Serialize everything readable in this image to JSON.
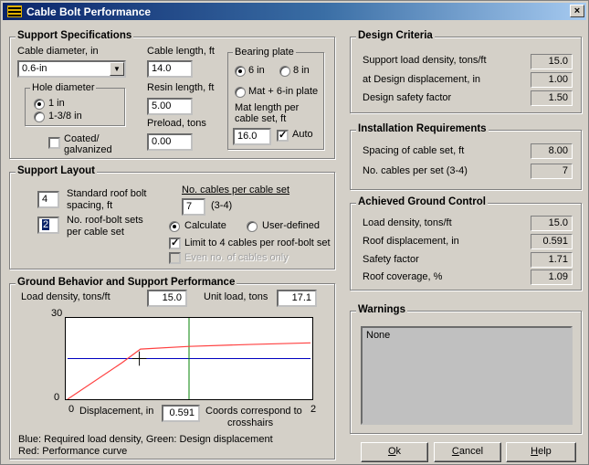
{
  "window": {
    "title": "Cable Bolt Performance",
    "close": "×"
  },
  "support_specs": {
    "title": "Support Specifications",
    "cable_diameter_label": "Cable diameter, in",
    "cable_diameter_value": "0.6-in",
    "cable_length_label": "Cable length, ft",
    "cable_length_value": "14.0",
    "resin_length_label": "Resin length, ft",
    "resin_length_value": "5.00",
    "preload_label": "Preload, tons",
    "preload_value": "0.00",
    "hole_diameter": {
      "title": "Hole diameter",
      "opt1": "1 in",
      "opt2": "1-3/8 in",
      "selected": "1 in"
    },
    "coated_label_1": "Coated/",
    "coated_label_2": "galvanized",
    "coated_checked": false,
    "bearing_plate": {
      "title": "Bearing plate",
      "opt1": "6 in",
      "opt2": "8 in",
      "opt3": "Mat + 6-in plate",
      "selected": "6 in",
      "mat_length_label_1": "Mat length per",
      "mat_length_label_2": "cable set, ft",
      "mat_length_value": "16.0",
      "auto_label": "Auto",
      "auto_checked": true
    }
  },
  "support_layout": {
    "title": "Support Layout",
    "roof_bolt_spacing_value": "4",
    "roof_bolt_spacing_label_1": "Standard roof bolt",
    "roof_bolt_spacing_label_2": "spacing, ft",
    "roof_bolt_sets_value": "2",
    "roof_bolt_sets_label_1": "No. roof-bolt sets",
    "roof_bolt_sets_label_2": "per cable set",
    "cables_per_set_label": "No. cables per cable set",
    "cables_per_set_value": "7",
    "cables_per_set_range": "(3-4)",
    "calculate_label": "Calculate",
    "user_defined_label": "User-defined",
    "mode_selected": "Calculate",
    "limit_label": "Limit to 4 cables per roof-bolt set",
    "limit_checked": true,
    "even_label": "Even no. of cables only",
    "even_checked": false
  },
  "ground_behavior": {
    "title": "Ground Behavior and Support Performance",
    "load_density_label": "Load density, tons/ft",
    "load_density_value": "15.0",
    "unit_load_label": "Unit load, tons",
    "unit_load_value": "17.1",
    "y_max": "30",
    "y_min": "0",
    "x_min": "0",
    "x_max": "2",
    "displacement_label": "Displacement, in",
    "displacement_value": "0.591",
    "coords_note_1": "Coords correspond to",
    "coords_note_2": "crosshairs",
    "legend_1": "Blue: Required load density, Green: Design displacement",
    "legend_2": "Red: Performance curve",
    "colors": {
      "required": "#0000c0",
      "design": "#008000",
      "performance": "#ff4040"
    }
  },
  "chart_data": {
    "type": "line",
    "xlim": [
      0,
      2
    ],
    "ylim": [
      0,
      30
    ],
    "series": [
      {
        "x": [
          0,
          0.45,
          0.6,
          1.0,
          1.5,
          2.0
        ],
        "y": [
          0,
          13.5,
          18.5,
          19.5,
          20.2,
          20.8
        ]
      }
    ],
    "required_load_density": 15.0,
    "design_displacement": 1.0,
    "crosshair": {
      "x": 0.591,
      "y": 15.0
    }
  },
  "design_criteria": {
    "title": "Design Criteria",
    "rows": [
      {
        "label": "Support load density, tons/ft",
        "value": "15.0"
      },
      {
        "label": "at Design displacement, in",
        "value": "1.00"
      },
      {
        "label": "Design safety factor",
        "value": "1.50"
      }
    ]
  },
  "installation": {
    "title": "Installation Requirements",
    "rows": [
      {
        "label": "Spacing of cable set, ft",
        "value": "8.00"
      },
      {
        "label": "No. cables per set (3-4)",
        "value": "7"
      }
    ]
  },
  "achieved": {
    "title": "Achieved Ground Control",
    "rows": [
      {
        "label": "Load density, tons/ft",
        "value": "15.0"
      },
      {
        "label": "Roof displacement, in",
        "value": "0.591"
      },
      {
        "label": "Safety factor",
        "value": "1.71"
      },
      {
        "label": "Roof coverage, %",
        "value": "1.09"
      }
    ]
  },
  "warnings": {
    "title": "Warnings",
    "text": "None"
  },
  "buttons": {
    "ok": "Ok",
    "cancel": "Cancel",
    "help": "Help"
  }
}
